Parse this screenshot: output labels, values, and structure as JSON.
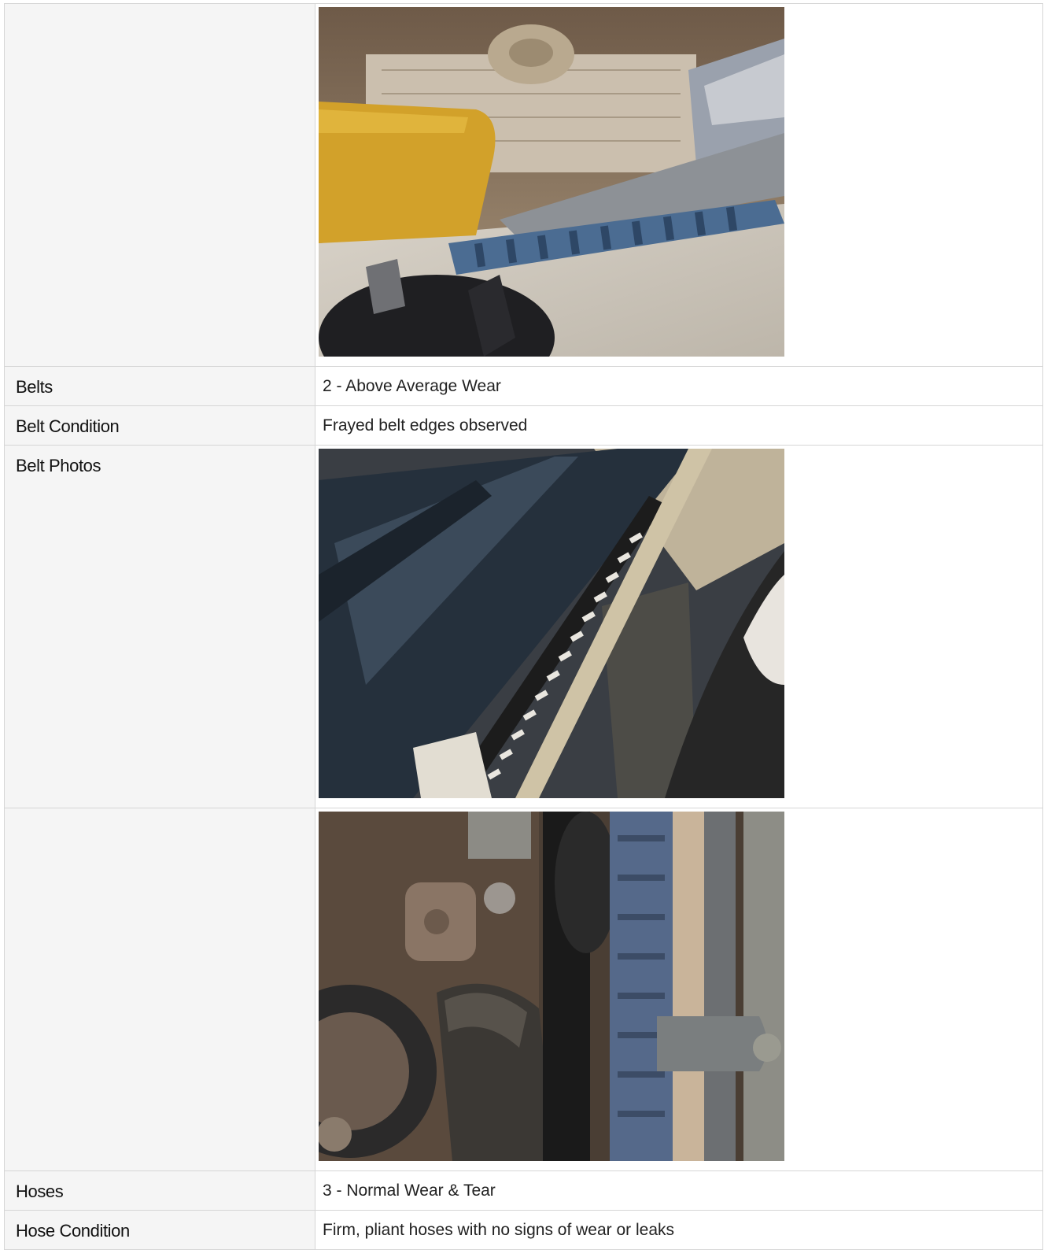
{
  "rows": [
    {
      "type": "photo",
      "label": "",
      "photo": "engine-bay-radiator-photo"
    },
    {
      "type": "text",
      "label": "Belts",
      "value": "2 - Above Average Wear"
    },
    {
      "type": "text",
      "label": "Belt Condition",
      "value": "Frayed belt edges observed"
    },
    {
      "type": "photo",
      "label": "Belt Photos",
      "photo": "belt-closeup-photo"
    },
    {
      "type": "photo",
      "label": "",
      "photo": "engine-pulley-hose-photo"
    },
    {
      "type": "text",
      "label": "Hoses",
      "value": "3 - Normal Wear & Tear"
    },
    {
      "type": "text",
      "label": "Hose Condition",
      "value": "Firm, pliant hoses with no signs of wear or leaks"
    }
  ],
  "colors": {
    "label_bg": "#f5f5f5",
    "border": "#d6d6d6",
    "value_bg": "#ffffff"
  }
}
